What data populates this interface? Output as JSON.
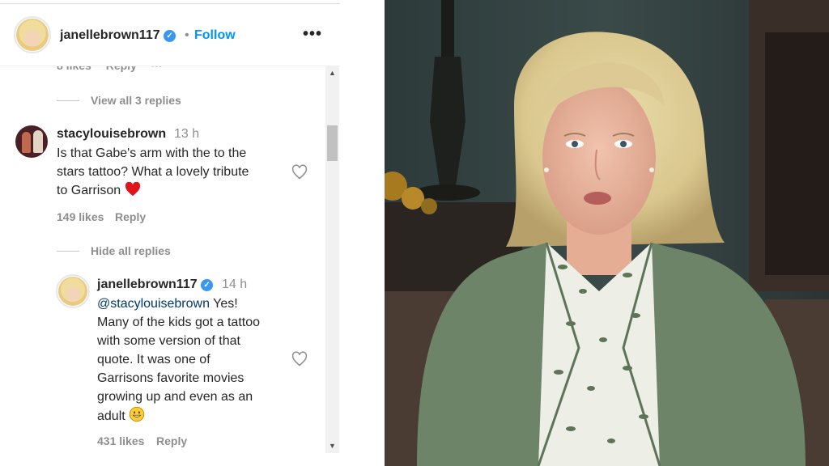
{
  "header": {
    "username": "janellebrown117",
    "verified_glyph": "✓",
    "dot": "•",
    "follow_label": "Follow",
    "more_label": "•••"
  },
  "clipped_row": {
    "likes": "8 likes",
    "reply": "Reply",
    "more": "···"
  },
  "view_replies": "View all 3 replies",
  "comment": {
    "username": "stacylouisebrown",
    "time": "13 h",
    "lines": [
      "Is that Gabe's arm with the to the",
      "stars tattoo? What a lovely tribute",
      "to Garrison"
    ],
    "likes": "149 likes",
    "reply": "Reply"
  },
  "hide_replies": "Hide all replies",
  "reply": {
    "username": "janellebrown117",
    "time": "14 h",
    "mention": "@stacylouisebrown",
    "first_line_rest": " Yes!",
    "lines": [
      "Many of the kids got a tattoo",
      "with some version of that",
      "quote. It was one of",
      "Garrisons favorite movies",
      "growing up and even as an",
      "adult"
    ],
    "likes": "431 likes",
    "reply": "Reply"
  },
  "scrollbar": {
    "up": "▲",
    "down": "▼"
  },
  "colors": {
    "accent": "#0095f6",
    "verified": "#3897f0",
    "heart_red": "#ed4956",
    "muted": "#8e8e8e"
  },
  "icons": [
    "verified-badge-icon",
    "more-options-icon",
    "heart-outline-icon",
    "red-heart-emoji",
    "grinning-face-emoji"
  ]
}
